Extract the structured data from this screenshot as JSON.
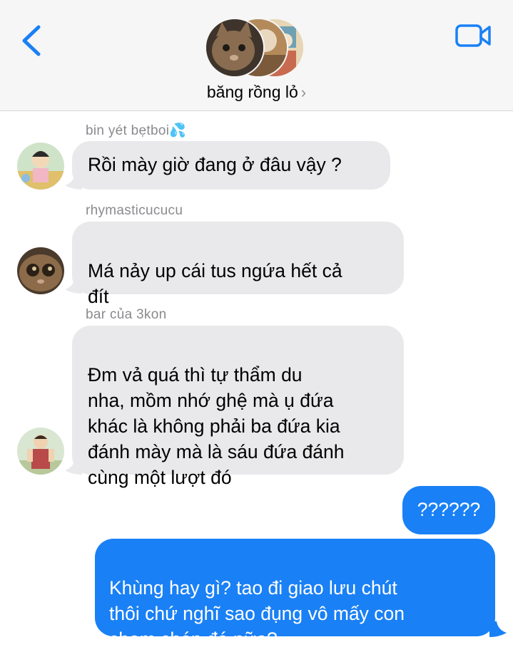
{
  "header": {
    "group_name": "băng rồng lỏ",
    "back_icon": "chevron-left-icon",
    "video_icon": "video-camera-icon",
    "accent_color": "#1a80f5"
  },
  "messages": [
    {
      "sender": "bin yét bẹtboi💦",
      "text": "Rồi mày giờ đang ở đâu vậy ?",
      "direction": "incoming"
    },
    {
      "sender": "rhymasticucucu",
      "text": "Má nảy up cái tus ngứa hết cả\nđít",
      "direction": "incoming"
    },
    {
      "sender": "bar của 3kon",
      "text": "Đm vả quá thì tự thẩm du\nnha, mồm nhớ ghệ mà ụ đứa\nkhác là không phải ba đứa kia\nđánh mày mà là sáu đứa đánh\ncùng một lượt đó",
      "direction": "incoming"
    },
    {
      "sender": "",
      "text": "??????",
      "direction": "outgoing"
    },
    {
      "sender": "",
      "text": "Khùng hay gì? tao đi giao lưu chút\nthôi chứ nghĩ sao đụng vô mấy con\nchem chép đó nữa?",
      "direction": "outgoing"
    }
  ]
}
